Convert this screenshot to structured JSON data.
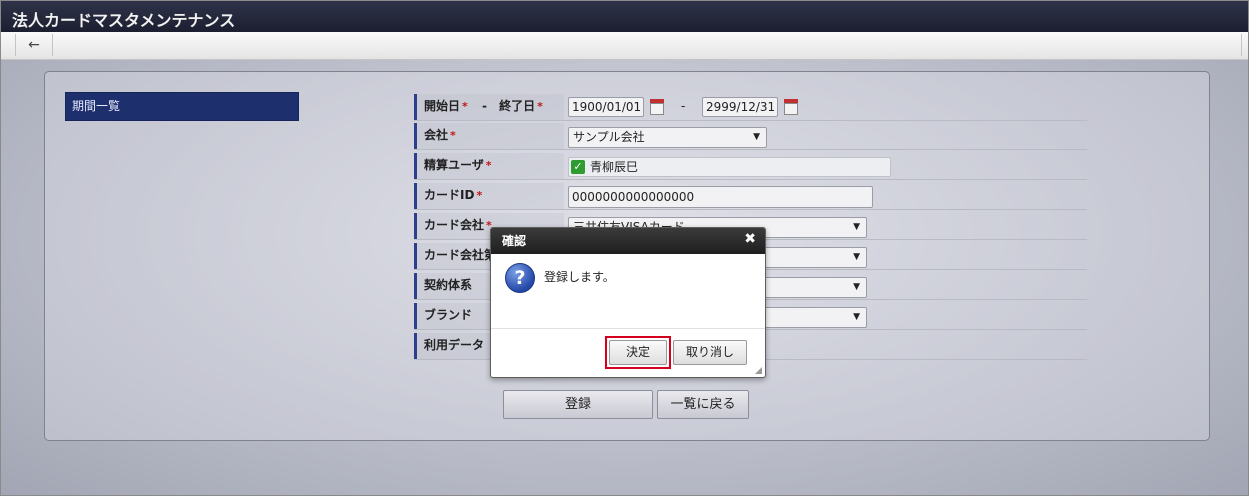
{
  "window": {
    "title": "法人カードマスタメンテナンス"
  },
  "toolbar": {
    "back_icon": "←"
  },
  "sidebar": {
    "items": [
      {
        "label": "期間一覧"
      }
    ]
  },
  "form": {
    "period": {
      "start_label": "開始日",
      "dash": "-",
      "end_label": "終了日",
      "start_value": "1900/01/01",
      "end_value": "2999/12/31",
      "required_mark": "*"
    },
    "company": {
      "label": "会社",
      "value": "サンプル会社",
      "required_mark": "*"
    },
    "settlement_user": {
      "label": "精算ユーザ",
      "value": "青柳辰巳",
      "required_mark": "*"
    },
    "card_id": {
      "label": "カードID",
      "value": "0000000000000000",
      "required_mark": "*"
    },
    "card_company": {
      "label": "カード会社",
      "value": "三井住友VISAカード",
      "required_mark": "*"
    },
    "card_company_2": {
      "label": "カード会社第"
    },
    "contract_system": {
      "label": "契約体系"
    },
    "brand": {
      "label": "ブランド"
    },
    "usage_data": {
      "label": "利用データ"
    }
  },
  "actions": {
    "register": "登録",
    "back_to_list": "一覧に戻る"
  },
  "dialog": {
    "title": "確認",
    "close_icon": "✖",
    "message": "登録します。",
    "ok": "決定",
    "cancel": "取り消し",
    "question_icon": "?"
  },
  "colors": {
    "title_bar": "#23273a",
    "sidebar_selected": "#1e2f6e",
    "required": "#c01818",
    "highlight": "#d4001e"
  }
}
